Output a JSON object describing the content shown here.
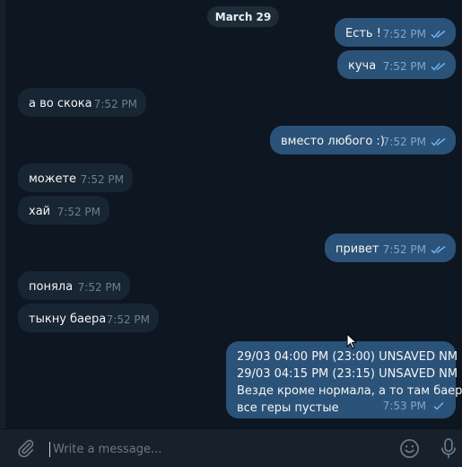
{
  "date_label": "March 29",
  "messages": [
    {
      "dir": "out",
      "text": "Есть !",
      "time": "7:52 PM"
    },
    {
      "dir": "out",
      "text": "куча",
      "time": "7:52 PM"
    },
    {
      "dir": "in",
      "text": "а во скока",
      "time": "7:52 PM"
    },
    {
      "dir": "out",
      "text": "вместо любого :)",
      "time": "7:52 PM"
    },
    {
      "dir": "in",
      "text": "можете",
      "time": "7:52 PM"
    },
    {
      "dir": "in",
      "text": "хай",
      "time": "7:52 PM"
    },
    {
      "dir": "out",
      "text": "привет",
      "time": "7:52 PM"
    },
    {
      "dir": "in",
      "text": "поняла",
      "time": "7:52 PM"
    },
    {
      "dir": "in",
      "text": "тыкну баера",
      "time": "7:52 PM"
    },
    {
      "dir": "out",
      "lines": [
        "29/03 04:00 PM (23:00) UNSAVED NM",
        "29/03 04:15 PM (23:15) UNSAVED NM",
        "Везде кроме нормала, а то там баеры",
        "все геры пустые"
      ],
      "time": "7:53 PM"
    }
  ],
  "composer": {
    "placeholder": "Write a message...",
    "attach_icon": "paperclip-icon",
    "emoji_icon": "emoji-icon",
    "mic_icon": "microphone-icon"
  },
  "colors": {
    "background": "#0e1621",
    "incoming_bubble": "#182533",
    "outgoing_bubble": "#2b5278",
    "composer": "#17212b",
    "tick": "#6ab3f3"
  }
}
